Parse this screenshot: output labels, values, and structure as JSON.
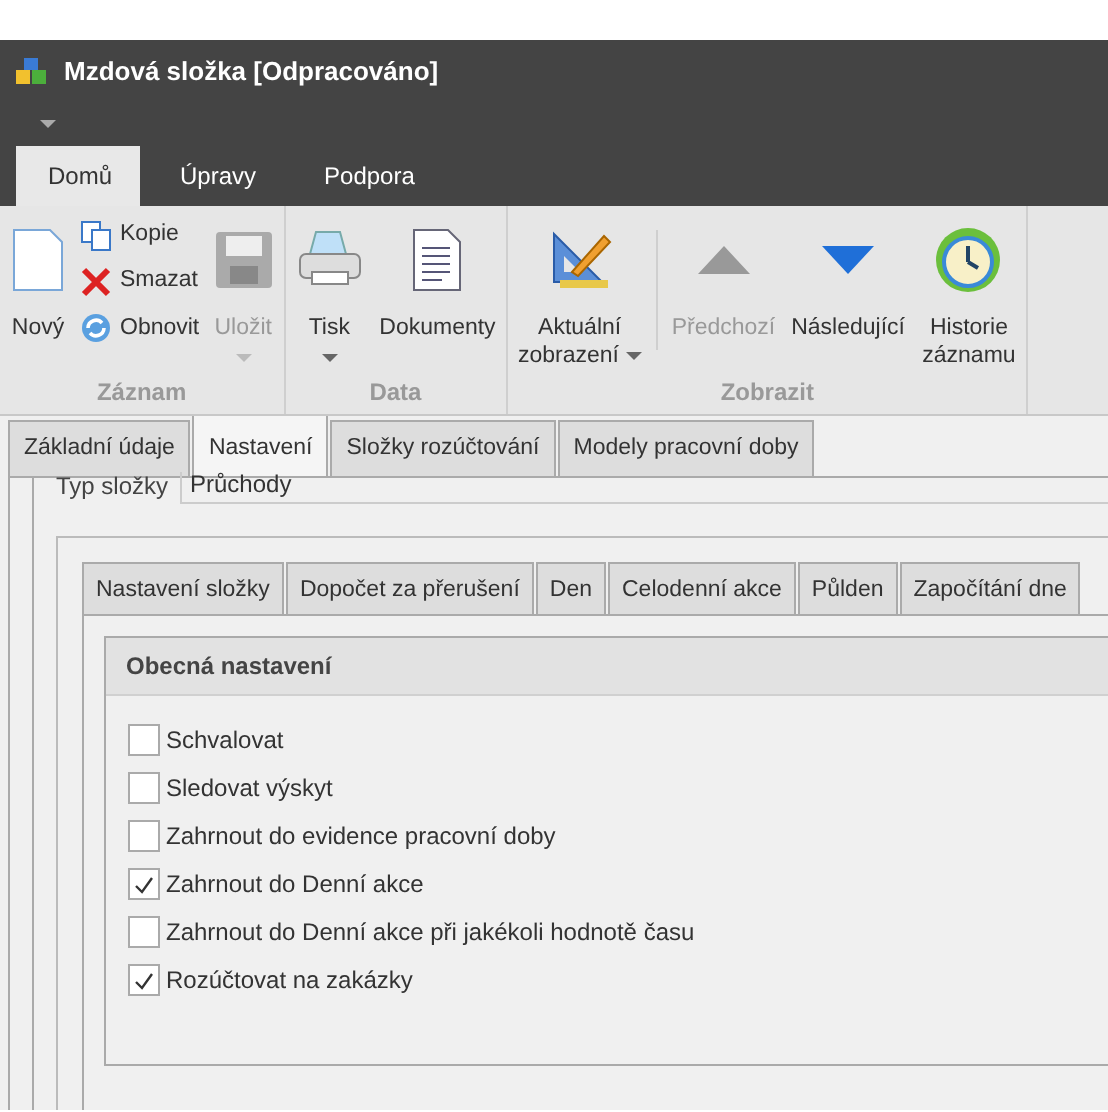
{
  "window": {
    "title": "Mzdová složka [Odpracováno]"
  },
  "ribbon": {
    "tabs": [
      {
        "label": "Domů",
        "selected": true
      },
      {
        "label": "Úpravy",
        "selected": false
      },
      {
        "label": "Podpora",
        "selected": false
      }
    ],
    "groups": [
      {
        "label": "Záznam",
        "items": [
          {
            "kind": "large",
            "label": "Nový"
          },
          {
            "kind": "small",
            "label": "Kopie"
          },
          {
            "kind": "small",
            "label": "Smazat"
          },
          {
            "kind": "small",
            "label": "Obnovit"
          },
          {
            "kind": "large",
            "label": "Uložit",
            "disabled": true,
            "dropdown": true
          }
        ]
      },
      {
        "label": "Data",
        "items": [
          {
            "kind": "large",
            "label": "Tisk",
            "dropdown": true
          },
          {
            "kind": "large",
            "label": "Dokumenty"
          }
        ]
      },
      {
        "label": "Zobrazit",
        "items": [
          {
            "kind": "large",
            "label": "Aktuální zobrazení",
            "dropdown": true
          },
          {
            "kind": "separator"
          },
          {
            "kind": "large",
            "label": "Předchozí",
            "disabled": true
          },
          {
            "kind": "large",
            "label": "Následující"
          },
          {
            "kind": "large",
            "label": "Historie záznamu"
          }
        ]
      }
    ]
  },
  "main_tabs": [
    {
      "label": "Základní údaje",
      "selected": false
    },
    {
      "label": "Nastavení",
      "selected": true
    },
    {
      "label": "Složky rozúčtování",
      "selected": false
    },
    {
      "label": "Modely pracovní doby",
      "selected": false
    }
  ],
  "field": {
    "label": "Typ složky",
    "value": "Průchody"
  },
  "sub_tabs": [
    {
      "label": "Nastavení složky"
    },
    {
      "label": "Dopočet za přerušení"
    },
    {
      "label": "Den"
    },
    {
      "label": "Celodenní akce"
    },
    {
      "label": "Půlden"
    },
    {
      "label": "Započítání dne"
    }
  ],
  "group": {
    "title": "Obecná nastavení",
    "checkboxes": [
      {
        "label": "Schvalovat",
        "checked": false
      },
      {
        "label": "Sledovat výskyt",
        "checked": false
      },
      {
        "label": "Zahrnout do evidence pracovní doby",
        "checked": false
      },
      {
        "label": "Zahrnout do Denní akce",
        "checked": true
      },
      {
        "label": "Zahrnout do Denní akce při jakékoli hodnotě času",
        "checked": false
      },
      {
        "label": "Rozúčtovat na zakázky",
        "checked": true
      }
    ]
  }
}
